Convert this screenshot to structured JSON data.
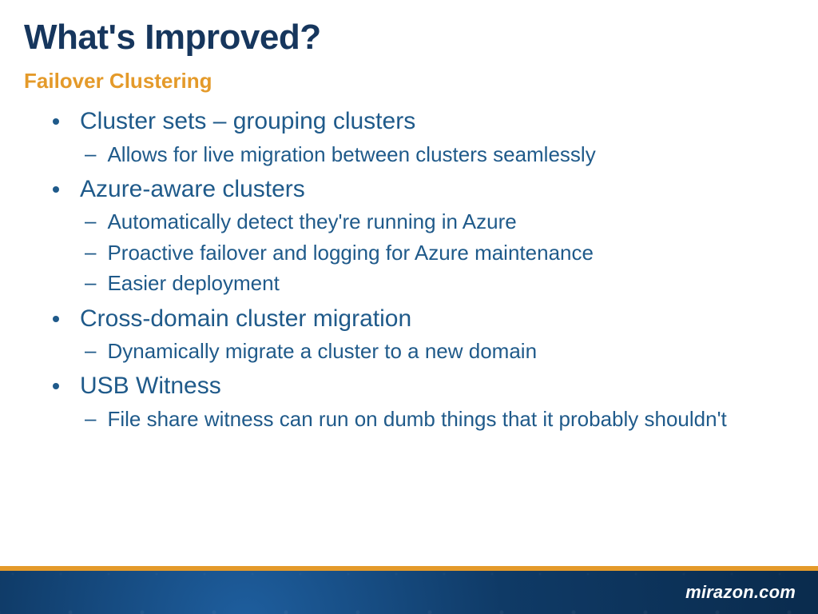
{
  "title": "What's Improved?",
  "subtitle": "Failover Clustering",
  "bullets": [
    {
      "text": "Cluster sets – grouping clusters",
      "sub": [
        "Allows for live migration between clusters seamlessly"
      ]
    },
    {
      "text": "Azure-aware clusters",
      "sub": [
        "Automatically detect they're running in Azure",
        "Proactive failover and logging for Azure maintenance",
        "Easier deployment"
      ]
    },
    {
      "text": "Cross-domain cluster migration",
      "sub": [
        "Dynamically migrate a cluster to a new domain"
      ]
    },
    {
      "text": "USB Witness",
      "sub": [
        "File share witness can run on dumb things that it probably shouldn't"
      ]
    }
  ],
  "brand": "mirazon.com"
}
